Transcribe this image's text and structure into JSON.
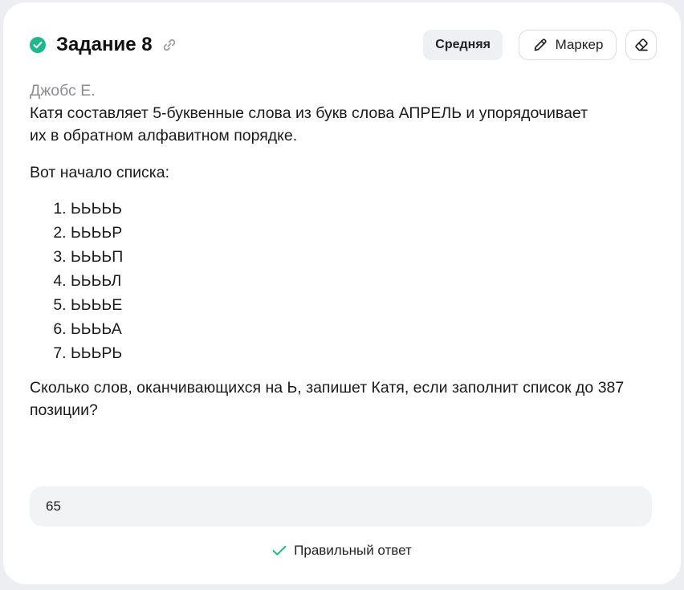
{
  "task": {
    "title": "Задание 8",
    "difficulty": "Средняя",
    "marker_label": "Маркер"
  },
  "problem": {
    "author": "Джобс Е.",
    "text_line1": "Катя составляет 5-буквенные слова из букв слова АПРЕЛЬ и упорядочивает",
    "text_line2": "их в обратном алфавитном порядке.",
    "list_intro": "Вот начало списка:",
    "words": [
      "ЬЬЬЬЬ",
      "ЬЬЬЬР",
      "ЬЬЬЬП",
      "ЬЬЬЬЛ",
      "ЬЬЬЬЕ",
      "ЬЬЬЬА",
      "ЬЬЬРЬ"
    ],
    "question_line1": "Сколько слов, оканчивающихся на Ь, запишет Катя, если заполнит список до 387",
    "question_line2": "позиции?"
  },
  "answer": {
    "value": "65",
    "status": "Правильный ответ"
  },
  "colors": {
    "success": "#1fb88e",
    "answer_bg": "#f2f3f5",
    "badge_bg": "#eef0f3"
  }
}
